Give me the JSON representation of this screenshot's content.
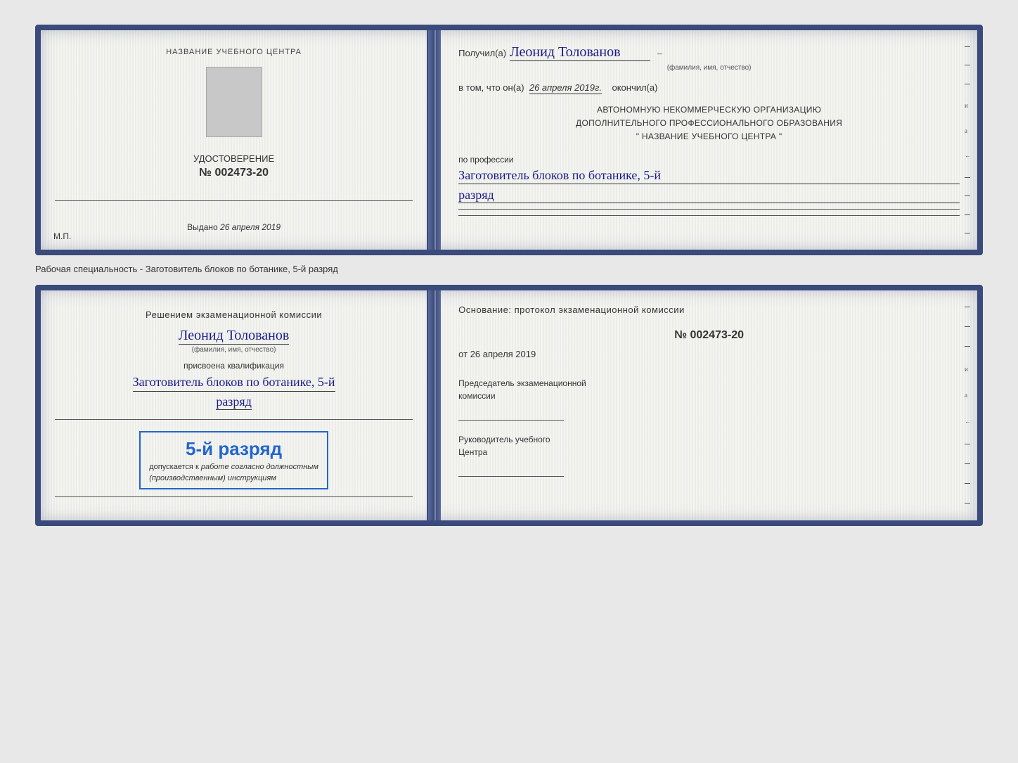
{
  "doc1": {
    "left": {
      "training_center_label": "НАЗВАНИЕ УЧЕБНОГО ЦЕНТРА",
      "cert_title": "УДОСТОВЕРЕНИЕ",
      "cert_number_prefix": "№",
      "cert_number": "002473-20",
      "issued_label": "Выдано",
      "issued_date": "26 апреля 2019",
      "mp_label": "М.П."
    },
    "right": {
      "received_label": "Получил(а)",
      "recipient_name": "Леонид Толованов",
      "fio_hint": "(фамилия, имя, отчество)",
      "date_line_prefix": "в том, что он(а)",
      "date_value": "26 апреля 2019г.",
      "date_line_suffix": "окончил(а)",
      "org_line1": "АВТОНОМНУЮ НЕКОММЕРЧЕСКУЮ ОРГАНИЗАЦИЮ",
      "org_line2": "ДОПОЛНИТЕЛЬНОГО ПРОФЕССИОНАЛЬНОГО ОБРАЗОВАНИЯ",
      "org_line3": "\"   НАЗВАНИЕ УЧЕБНОГО ЦЕНТРА   \"",
      "profession_label": "по профессии",
      "profession_value": "Заготовитель блоков по ботанике, 5-й",
      "razryad_value": "разряд"
    }
  },
  "caption": "Рабочая специальность - Заготовитель блоков по ботанике, 5-й разряд",
  "doc2": {
    "left": {
      "decision_title": "Решением экзаменационной комиссии",
      "person_name": "Леонид Толованов",
      "fio_hint": "(фамилия, имя, отчество)",
      "qualification_label": "присвоена квалификация",
      "qualification_value": "Заготовитель блоков по ботанике, 5-й",
      "razryad_value": "разряд",
      "stamp_rank": "5-й разряд",
      "stamp_admit_prefix": "допускается к",
      "stamp_admit_link": "работе согласно должностным",
      "stamp_admit_suffix": "(производственным) инструкциям"
    },
    "right": {
      "basis_title": "Основание: протокол экзаменационной комиссии",
      "protocol_number": "№  002473-20",
      "from_label": "от",
      "from_date": "26 апреля 2019",
      "chair_label1": "Председатель экзаменационной",
      "chair_label2": "комиссии",
      "head_label1": "Руководитель учебного",
      "head_label2": "Центра"
    }
  },
  "edge_dashes": [
    "–",
    "–",
    "–",
    "и",
    "а",
    "←",
    "–",
    "–",
    "–",
    "–"
  ],
  "edge_dashes2": [
    "–",
    "–",
    "–",
    "и",
    "а",
    "←",
    "–",
    "–",
    "–",
    "–"
  ]
}
